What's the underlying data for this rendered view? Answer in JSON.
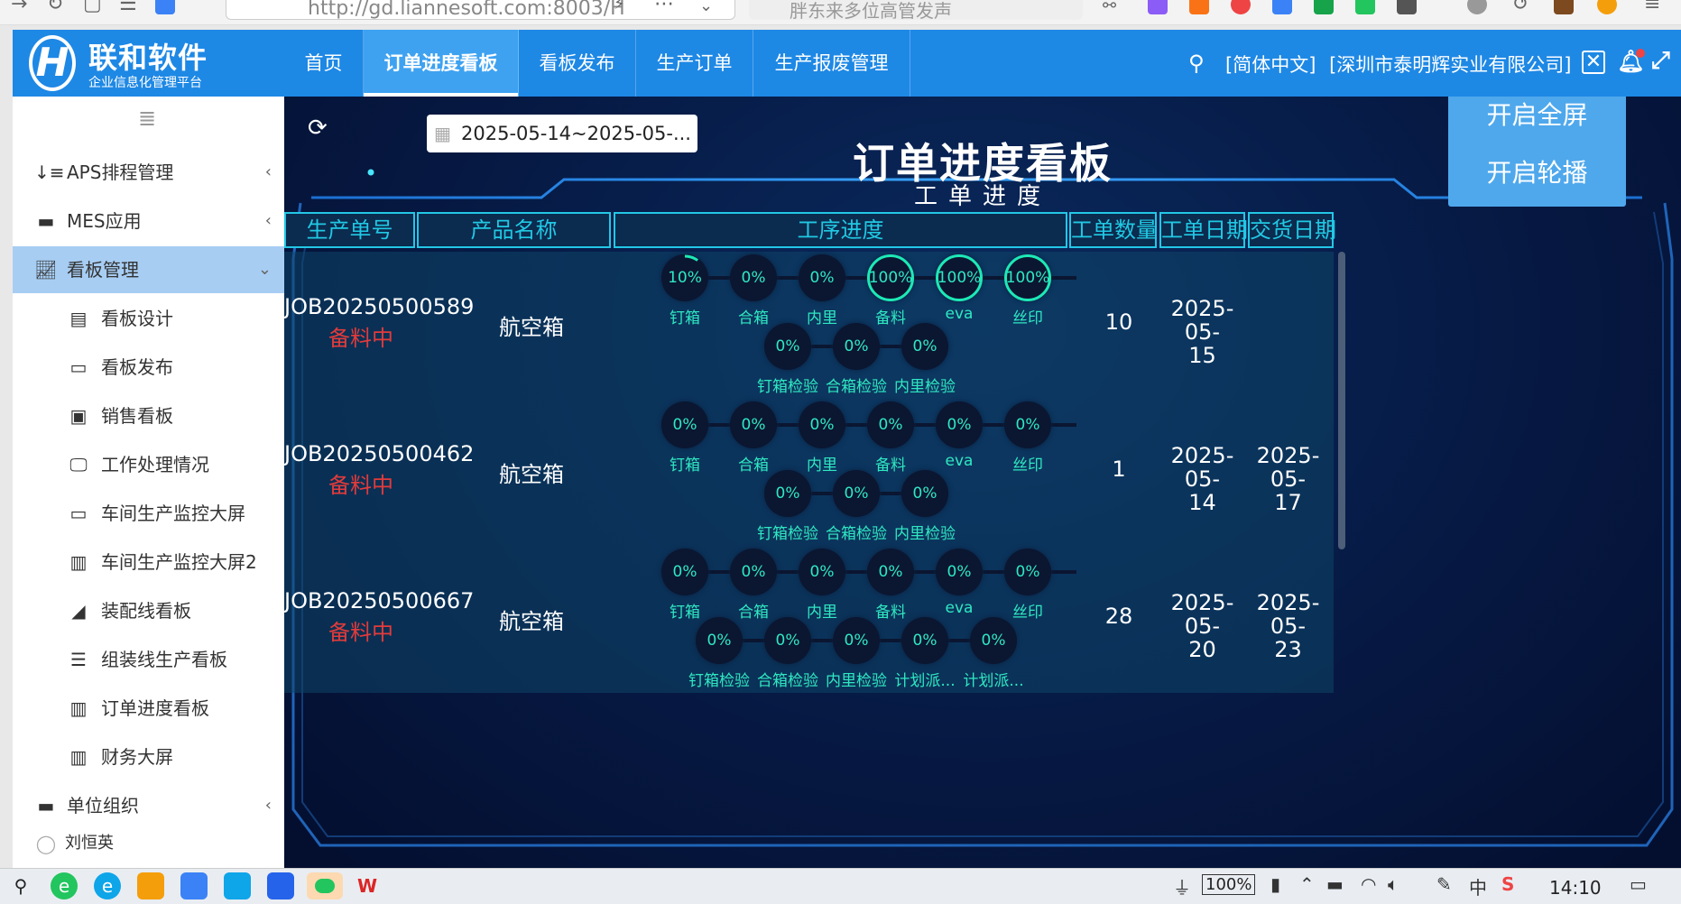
{
  "browser": {
    "url": "http://gd.liannesoft.com:8003/H",
    "search_placeholder": "胖东来多位高管发声"
  },
  "logo": {
    "mark": "H",
    "name": "联和软件",
    "tagline": "企业信息化管理平台"
  },
  "topnav": {
    "tabs": [
      {
        "label": "首页"
      },
      {
        "label": "订单进度看板"
      },
      {
        "label": "看板发布"
      },
      {
        "label": "生产订单"
      },
      {
        "label": "生产报废管理"
      }
    ],
    "language": "[简体中文]",
    "company": "[深圳市泰明辉实业有限公司]"
  },
  "sidebar": {
    "items": [
      {
        "label": "APS排程管理",
        "icon": "aps-icon"
      },
      {
        "label": "MES应用",
        "icon": "mes-icon"
      },
      {
        "label": "看板管理",
        "icon": "chart-line-icon"
      },
      {
        "label": "看板设计"
      },
      {
        "label": "看板发布"
      },
      {
        "label": "销售看板"
      },
      {
        "label": "工作处理情况"
      },
      {
        "label": "车间生产监控大屏"
      },
      {
        "label": "车间生产监控大屏2"
      },
      {
        "label": "装配线看板"
      },
      {
        "label": "组装线生产看板"
      },
      {
        "label": "订单进度看板"
      },
      {
        "label": "财务大屏"
      },
      {
        "label": "单位组织"
      }
    ],
    "user": "刘恒英"
  },
  "board": {
    "date_range": "2025-05-14~2025-05-...",
    "title": "订单进度看板",
    "fullscreen_button": "开启全屏",
    "carousel_button": "开启轮播",
    "section_title": "工单进度",
    "headers": [
      "生产单号",
      "产品名称",
      "工序进度",
      "工单数量",
      "工单日期",
      "交货日期"
    ],
    "rows": [
      {
        "job": "JOB20250500589",
        "status": "备料中",
        "product": "航空箱",
        "qty": "10",
        "order_date_1": "2025-05-",
        "order_date_2": "15",
        "delivery_date_1": "",
        "delivery_date_2": "",
        "procs_top": [
          {
            "name": "钉箱",
            "value": "10%",
            "progress": 0.1
          },
          {
            "name": "合箱",
            "value": "0%",
            "progress": 0
          },
          {
            "name": "内里",
            "value": "0%",
            "progress": 0
          },
          {
            "name": "备料",
            "value": "100%",
            "progress": 1
          },
          {
            "name": "eva",
            "value": "100%",
            "progress": 1
          },
          {
            "name": "丝印",
            "value": "100%",
            "progress": 1
          }
        ],
        "procs_bottom": [
          {
            "name": "钉箱检验",
            "value": "0%",
            "progress": 0
          },
          {
            "name": "合箱检验",
            "value": "0%",
            "progress": 0
          },
          {
            "name": "内里检验",
            "value": "0%",
            "progress": 0
          }
        ]
      },
      {
        "job": "JOB20250500462",
        "status": "备料中",
        "product": "航空箱",
        "qty": "1",
        "order_date_1": "2025-05-",
        "order_date_2": "14",
        "delivery_date_1": "2025-05-",
        "delivery_date_2": "17",
        "procs_top": [
          {
            "name": "钉箱",
            "value": "0%",
            "progress": 0
          },
          {
            "name": "合箱",
            "value": "0%",
            "progress": 0
          },
          {
            "name": "内里",
            "value": "0%",
            "progress": 0
          },
          {
            "name": "备料",
            "value": "0%",
            "progress": 0
          },
          {
            "name": "eva",
            "value": "0%",
            "progress": 0
          },
          {
            "name": "丝印",
            "value": "0%",
            "progress": 0
          }
        ],
        "procs_bottom": [
          {
            "name": "钉箱检验",
            "value": "0%",
            "progress": 0
          },
          {
            "name": "合箱检验",
            "value": "0%",
            "progress": 0
          },
          {
            "name": "内里检验",
            "value": "0%",
            "progress": 0
          }
        ]
      },
      {
        "job": "JOB20250500667",
        "status": "备料中",
        "product": "航空箱",
        "qty": "28",
        "order_date_1": "2025-05-",
        "order_date_2": "20",
        "delivery_date_1": "2025-05-",
        "delivery_date_2": "23",
        "procs_top": [
          {
            "name": "钉箱",
            "value": "0%",
            "progress": 0
          },
          {
            "name": "合箱",
            "value": "0%",
            "progress": 0
          },
          {
            "name": "内里",
            "value": "0%",
            "progress": 0
          },
          {
            "name": "备料",
            "value": "0%",
            "progress": 0
          },
          {
            "name": "eva",
            "value": "0%",
            "progress": 0
          },
          {
            "name": "丝印",
            "value": "0%",
            "progress": 0
          }
        ],
        "procs_bottom": [
          {
            "name": "钉箱检验",
            "value": "0%",
            "progress": 0
          },
          {
            "name": "合箱检验",
            "value": "0%",
            "progress": 0
          },
          {
            "name": "内里检验",
            "value": "0%",
            "progress": 0
          },
          {
            "name": "计划派...",
            "value": "0%",
            "progress": 0
          },
          {
            "name": "计划派...",
            "value": "0%",
            "progress": 0
          }
        ]
      }
    ]
  },
  "taskbar": {
    "battery": "100%",
    "ime": "中",
    "time": "14:10"
  },
  "colors": {
    "accent": "#1e88e5",
    "board_bg": "#061943",
    "cyan": "#21c8e3",
    "progress_green": "#1de9b6",
    "status_red": "#e23b3b"
  }
}
